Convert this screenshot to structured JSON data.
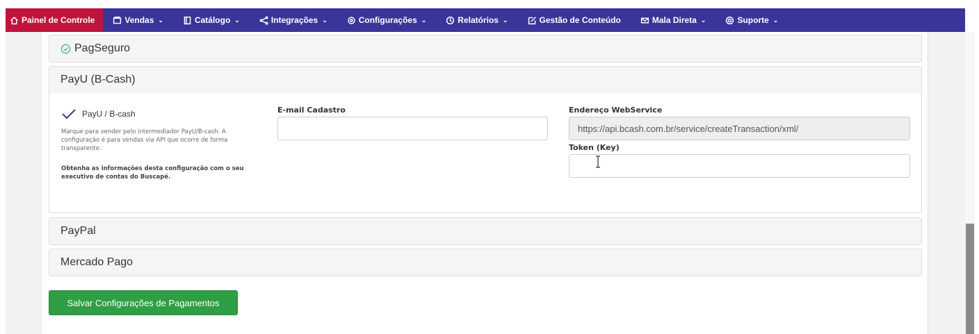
{
  "nav": {
    "items": [
      {
        "label": "Painel de Controle",
        "icon": "home-icon",
        "active": true
      },
      {
        "label": "Vendas",
        "icon": "bag-icon",
        "dropdown": true
      },
      {
        "label": "Catálogo",
        "icon": "book-icon",
        "dropdown": true
      },
      {
        "label": "Integrações",
        "icon": "share-icon",
        "dropdown": true
      },
      {
        "label": "Configurações",
        "icon": "gear-icon",
        "dropdown": true
      },
      {
        "label": "Relatórios",
        "icon": "clock-icon",
        "dropdown": true
      },
      {
        "label": "Gestão de Conteúdo",
        "icon": "edit-icon"
      },
      {
        "label": "Mala Direta",
        "icon": "mail-icon",
        "dropdown": true
      },
      {
        "label": "Suporte",
        "icon": "lifebuoy-icon",
        "dropdown": true
      }
    ],
    "chevron": "⌄",
    "colors": {
      "bar": "#3a3599",
      "active": "#c0143c"
    }
  },
  "payments": {
    "pagseguro": {
      "title": "PagSeguro",
      "status_icon": "check-circle-icon",
      "status_color": "#3cb371"
    },
    "payu": {
      "title": "PayU (B-Cash)",
      "method_label": "PayU / B-cash",
      "method_icon": "check-icon",
      "description": "Marque para vender pelo intermediador PayU/B-cash. A configuração é para vendas via API que ocorre de forma transparente.",
      "description_bold": "Obtenha as informações desta configuração com o seu executivo de contas do Buscapé.",
      "email_label": "E-mail Cadastro",
      "email_value": "",
      "webservice_label": "Endereço WebService",
      "webservice_value": "https://api.bcash.com.br/service/createTransaction/xml/",
      "token_label": "Token (Key)",
      "token_value": ""
    },
    "paypal": {
      "title": "PayPal"
    },
    "mercadopago": {
      "title": "Mercado Pago"
    }
  },
  "save_button": {
    "label": "Salvar Configurações de Pagamentos",
    "color": "#2f9e44"
  }
}
